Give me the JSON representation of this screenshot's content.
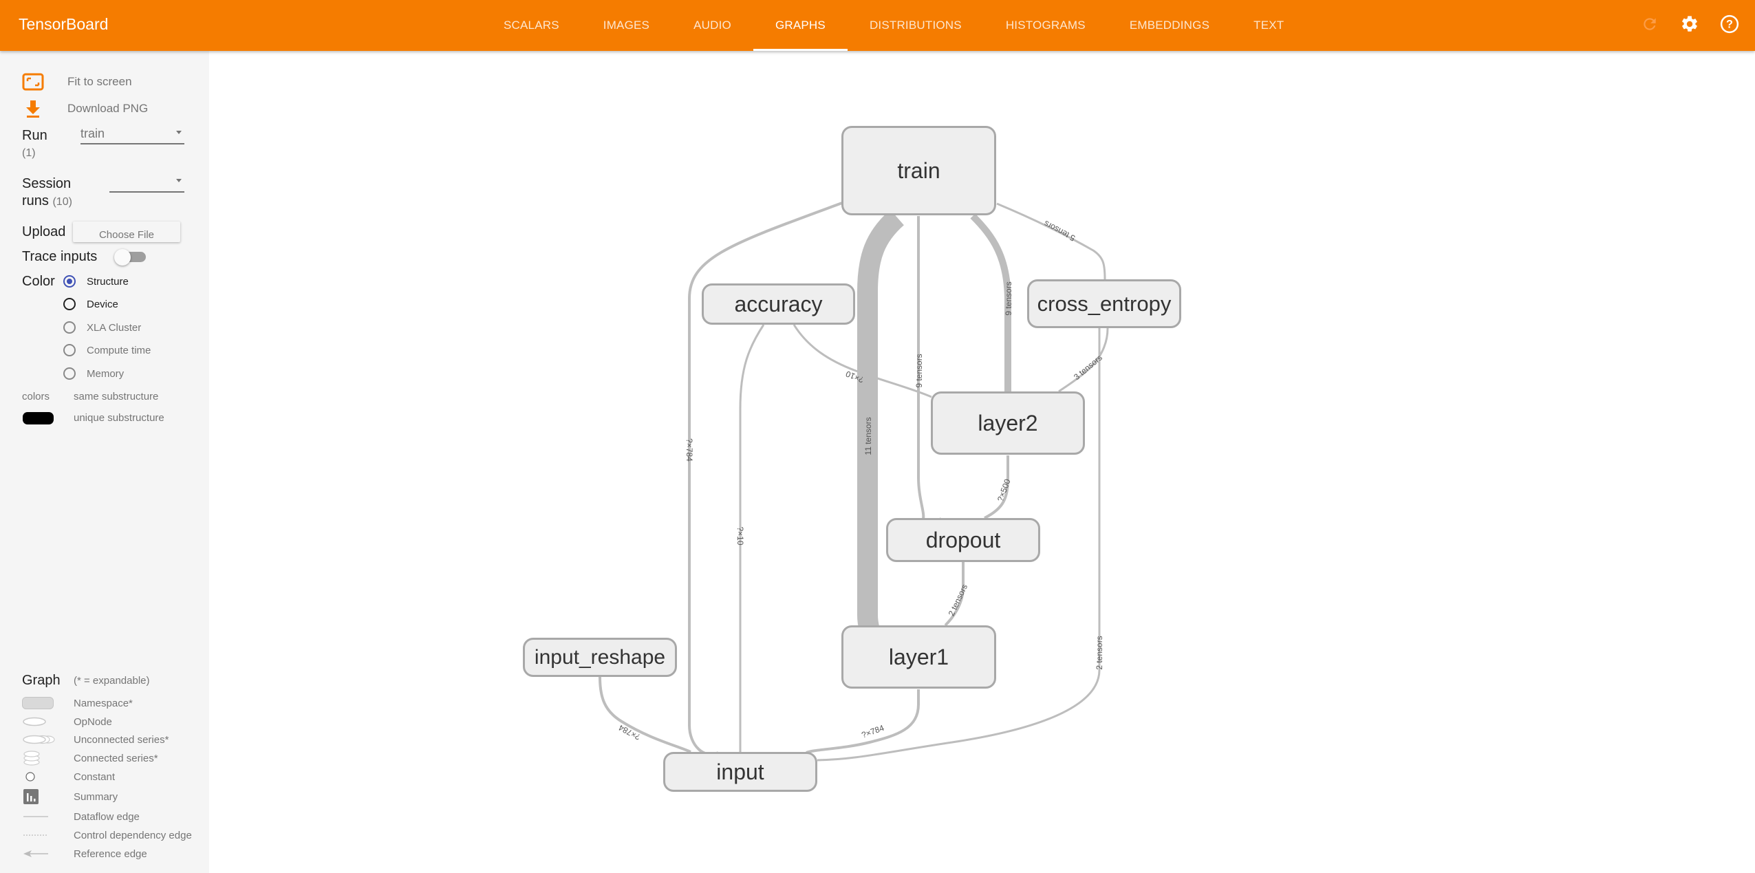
{
  "app": {
    "title": "TensorBoard",
    "accent_color": "#f57c00"
  },
  "tabs": [
    {
      "label": "SCALARS",
      "active": false
    },
    {
      "label": "IMAGES",
      "active": false
    },
    {
      "label": "AUDIO",
      "active": false
    },
    {
      "label": "GRAPHS",
      "active": true
    },
    {
      "label": "DISTRIBUTIONS",
      "active": false
    },
    {
      "label": "HISTOGRAMS",
      "active": false
    },
    {
      "label": "EMBEDDINGS",
      "active": false
    },
    {
      "label": "TEXT",
      "active": false
    }
  ],
  "toolbar_icons": [
    "refresh-icon",
    "settings-icon",
    "help-icon"
  ],
  "sidebar": {
    "fit_to_screen": "Fit to screen",
    "download_png": "Download PNG",
    "run_label": "Run",
    "run_count": "(1)",
    "run_value": "train",
    "session_label_1": "Session",
    "session_label_2": "runs",
    "session_count": "(10)",
    "session_value": "",
    "upload_label": "Upload",
    "choose_file": "Choose File",
    "trace_inputs": "Trace inputs",
    "trace_inputs_on": false,
    "color_label": "Color",
    "color_options": [
      {
        "label": "Structure",
        "checked": true
      },
      {
        "label": "Device",
        "checked": false
      },
      {
        "label": "XLA Cluster",
        "checked": false
      },
      {
        "label": "Compute time",
        "checked": false
      },
      {
        "label": "Memory",
        "checked": false
      }
    ],
    "colors_label": "colors",
    "same_substructure": "same substructure",
    "unique_substructure": "unique substructure",
    "graph_label": "Graph",
    "expandable_note": "(* = expandable)",
    "legend": [
      {
        "icon": "namespace-icon",
        "label": "Namespace*"
      },
      {
        "icon": "opnode-icon",
        "label": "OpNode"
      },
      {
        "icon": "unconnected-series-icon",
        "label": "Unconnected series*"
      },
      {
        "icon": "connected-series-icon",
        "label": "Connected series*"
      },
      {
        "icon": "constant-icon",
        "label": "Constant"
      },
      {
        "icon": "summary-icon",
        "label": "Summary"
      },
      {
        "icon": "dataflow-edge-icon",
        "label": "Dataflow edge"
      },
      {
        "icon": "control-dependency-edge-icon",
        "label": "Control dependency edge"
      },
      {
        "icon": "reference-edge-icon",
        "label": "Reference edge"
      }
    ]
  },
  "graph": {
    "nodes": [
      {
        "id": "train",
        "label": "train"
      },
      {
        "id": "accuracy",
        "label": "accuracy"
      },
      {
        "id": "cross_entropy",
        "label": "cross_entropy"
      },
      {
        "id": "layer2",
        "label": "layer2"
      },
      {
        "id": "dropout",
        "label": "dropout"
      },
      {
        "id": "layer1",
        "label": "layer1"
      },
      {
        "id": "input_reshape",
        "label": "input_reshape"
      },
      {
        "id": "input",
        "label": "input"
      }
    ],
    "edges": [
      {
        "from": "input",
        "to": "train",
        "label": "?×784"
      },
      {
        "from": "input",
        "to": "accuracy",
        "label": "?×10"
      },
      {
        "from": "layer1",
        "to": "train",
        "label": "11 tensors"
      },
      {
        "from": "dropout",
        "to": "train",
        "label": "9 tensors"
      },
      {
        "from": "layer2",
        "to": "train",
        "label": "9 tensors"
      },
      {
        "from": "cross_entropy",
        "to": "train",
        "label": "5 tensors"
      },
      {
        "from": "layer2",
        "to": "accuracy",
        "label": "?×10"
      },
      {
        "from": "layer2",
        "to": "cross_entropy",
        "label": "3 tensors"
      },
      {
        "from": "dropout",
        "to": "layer2",
        "label": "?×500"
      },
      {
        "from": "layer1",
        "to": "dropout",
        "label": "2 tensors"
      },
      {
        "from": "input",
        "to": "layer1",
        "label": "?×784"
      },
      {
        "from": "input",
        "to": "input_reshape",
        "label": "?×784"
      },
      {
        "from": "input",
        "to": "cross_entropy",
        "label": "2 tensors"
      }
    ]
  }
}
